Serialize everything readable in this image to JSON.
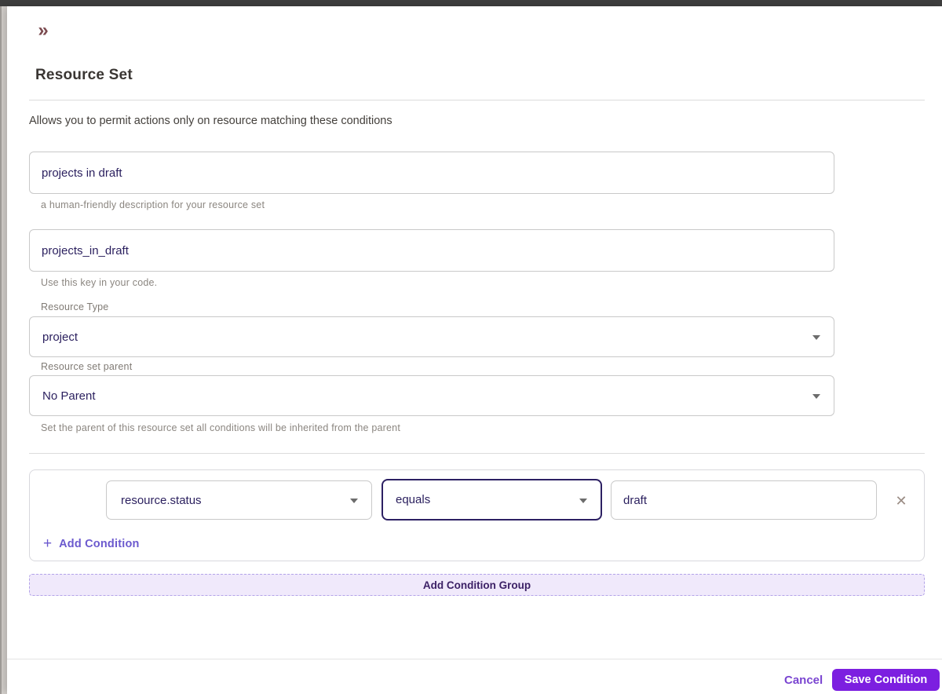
{
  "drawer": {
    "collapse_icon": "»",
    "title": "Resource Set",
    "description": "Allows you to permit actions only on resource matching these conditions",
    "fields": {
      "name": {
        "value": "projects in draft",
        "helper": "a human-friendly description for your resource set"
      },
      "key": {
        "value": "projects_in_draft",
        "helper": "Use this key in your code."
      },
      "resource_type": {
        "label": "Resource Type",
        "value": "project"
      },
      "parent": {
        "label": "Resource set parent",
        "value": "No Parent",
        "helper": "Set the parent of this resource set all conditions will be inherited from the parent"
      }
    },
    "condition_group": {
      "attribute": "resource.status",
      "operator": "equals",
      "value": "draft",
      "remove_icon": "✕",
      "plus_icon": "+",
      "add_condition_label": "Add Condition"
    },
    "add_condition_group_label": "Add Condition Group",
    "footer": {
      "cancel_label": "Cancel",
      "save_label": "Save Condition"
    }
  },
  "colors": {
    "accent_purple": "#7c1fe0",
    "link_purple": "#6b59ce",
    "input_text": "#2a1f5e",
    "focused_border": "#2c2063",
    "chevron_maroon": "#7b4a4f",
    "topbar": "#3e3e3e",
    "group_button_bg": "#f0e9fb"
  }
}
